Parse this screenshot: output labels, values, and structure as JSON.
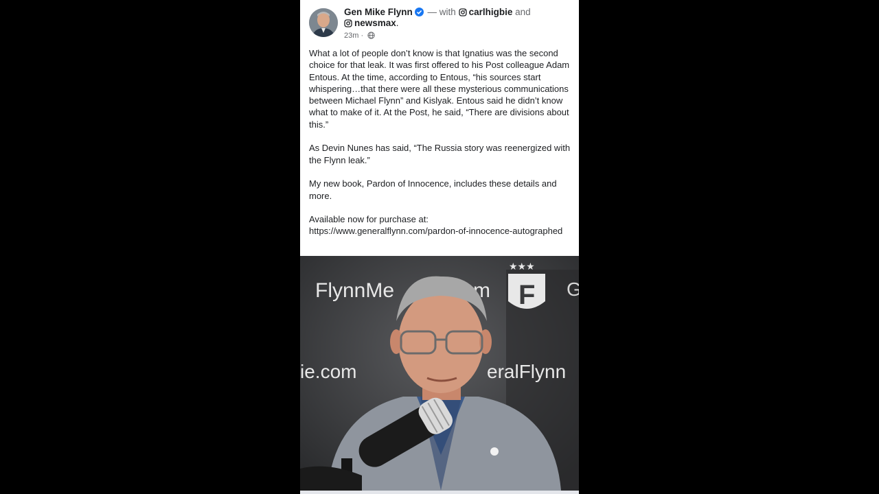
{
  "post": {
    "author": "Gen Mike Flynn",
    "with_text": "— with",
    "tagged_1": "carlhigbie",
    "and_text": "and",
    "tagged_2": "newsmax",
    "tagged_2_suffix": ".",
    "timestamp": "23m",
    "separator": "·",
    "paragraphs": [
      "What a lot of people don’t know is that Ignatius was the second choice for that leak. It was first offered to his Post colleague Adam Entous. At the time, according to Entous, “his sources start whispering…that there were all these mysterious communications between Michael Flynn” and Kislyak. Entous said he didn’t know what to make of it. At the Post, he said, “There are divisions about this.”",
      "As Devin Nunes has said, “The Russia story was reenergized with the Flynn leak.”",
      "My new book, Pardon of Innocence, includes these details and more."
    ],
    "available_label": "Available now for purchase at:",
    "link": "https://www.generalflynn.com/pardon-of-innocence-autographed"
  },
  "video_backdrop": {
    "text_left": "FlynnMe",
    "text_left_tail": "m",
    "text_right_partial": "G",
    "text_mid_left": "ie.com",
    "text_mid_right": "eralFlynn",
    "logo_letter": "F",
    "stars": "★★★"
  },
  "colors": {
    "verified": "#1877f2",
    "text": "#1c1e21",
    "muted": "#65676b"
  },
  "icons": [
    "verified-badge-icon",
    "instagram-icon",
    "globe-icon"
  ]
}
